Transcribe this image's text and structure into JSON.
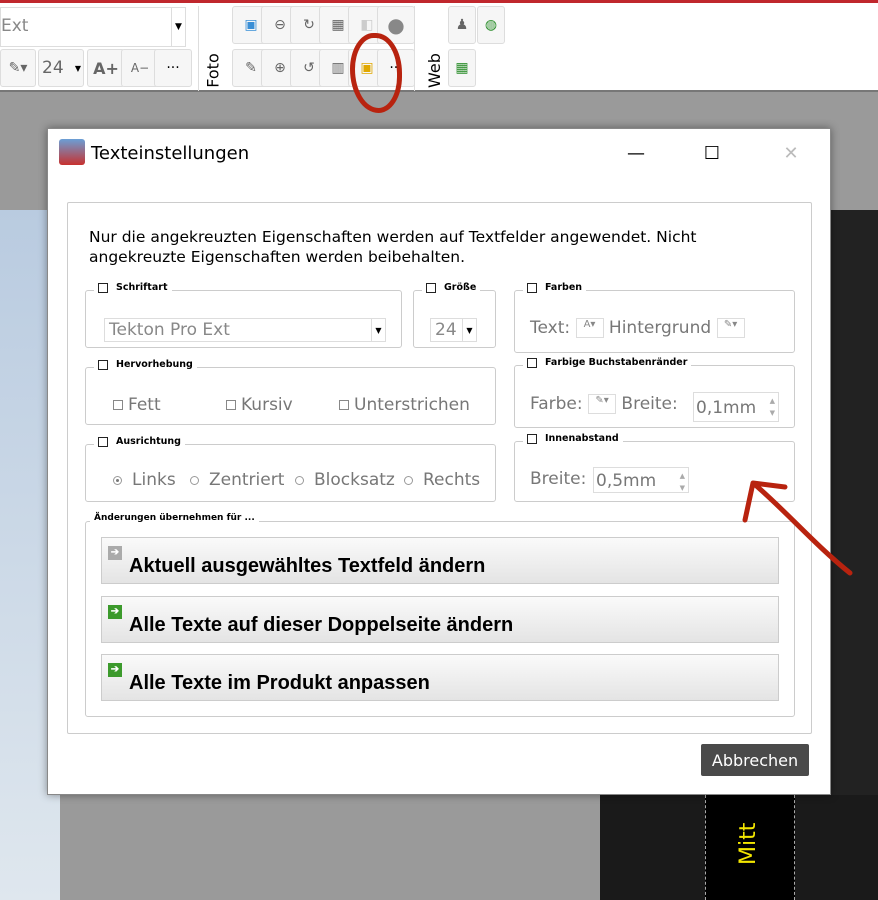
{
  "toolbar": {
    "font_value": "Ext",
    "font_size": "24",
    "grow_label": "A+",
    "shrink_label": "A−",
    "more_label": "···",
    "foto_label": "Foto",
    "web_label": "Web"
  },
  "dialog": {
    "title": "Texteinstellungen",
    "intro": "Nur die angekreuzten Eigenschaften werden auf Textfelder angewendet. Nicht angekreuzte Eigenschaften werden beibehalten.",
    "schriftart": {
      "label": "Schriftart",
      "value": "Tekton Pro Ext"
    },
    "groesse": {
      "label": "Größe",
      "value": "24"
    },
    "farben": {
      "label": "Farben",
      "text_label": "Text:",
      "bg_label": "Hintergrund"
    },
    "hervorhebung": {
      "label": "Hervorhebung",
      "options": [
        "Fett",
        "Kursiv",
        "Unterstrichen"
      ]
    },
    "buchstabenraender": {
      "label": "Farbige Buchstabenränder",
      "color_label": "Farbe:",
      "width_label": "Breite:",
      "width_value": "0,1mm"
    },
    "ausrichtung": {
      "label": "Ausrichtung",
      "options": [
        "Links",
        "Zentriert",
        "Blocksatz",
        "Rechts"
      ],
      "selected": "Links"
    },
    "innenabstand": {
      "label": "Innenabstand",
      "width_label": "Breite:",
      "width_value": "0,5mm"
    },
    "apply": {
      "label": "Änderungen übernehmen für ...",
      "buttons": [
        "Aktuell ausgewähltes Textfeld ändern",
        "Alle Texte auf dieser Doppelseite ändern",
        "Alle Texte im Produkt anpassen"
      ]
    },
    "cancel": "Abbrechen"
  },
  "background": {
    "band_text": "Mitt"
  },
  "colors": {
    "accent_red": "#c0272d",
    "annotation": "#b8230f",
    "cancel_bg": "#4a4a4a"
  }
}
